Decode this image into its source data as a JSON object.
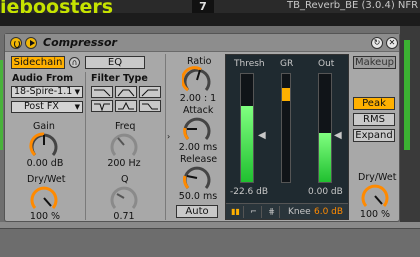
{
  "topbar": {
    "logo": "ieboosters",
    "key": "7",
    "track_name": "TB_Reverb_BE (3.0.4) NFR"
  },
  "device": {
    "title": "Compressor",
    "sidechain_label": "Sidechain",
    "eq_label": "EQ",
    "audio_from_label": "Audio From",
    "audio_from_value": "18-Spire-1.1",
    "post_fx_value": "Post FX",
    "filter_type_label": "Filter Type",
    "gain": {
      "label": "Gain",
      "value": "0.00 dB"
    },
    "sc_drywet": {
      "label": "Dry/Wet",
      "value": "100 %"
    },
    "freq": {
      "label": "Freq",
      "value": "200 Hz"
    },
    "q": {
      "label": "Q",
      "value": "0.71"
    },
    "ratio": {
      "label": "Ratio",
      "value": "2.00 : 1"
    },
    "attack": {
      "label": "Attack",
      "value": "2.00 ms"
    },
    "release": {
      "label": "Release",
      "value": "50.0 ms"
    },
    "auto_label": "Auto",
    "makeup_label": "Makeup",
    "peak_label": "Peak",
    "rms_label": "RMS",
    "expand_label": "Expand",
    "drywet": {
      "label": "Dry/Wet",
      "value": "100 %"
    },
    "meters": {
      "thresh_label": "Thresh",
      "gr_label": "GR",
      "out_label": "Out",
      "thresh_value": "-22.6 dB",
      "out_value": "0.00 dB",
      "knee_label": "Knee",
      "knee_value": "6.0 dB",
      "thresh_level": 0.7,
      "gr_level": 0.12,
      "out_level": 0.45
    },
    "colors": {
      "accent": "#ffb000",
      "meter_green": "#20c030",
      "knee_value": "#ff8a00"
    }
  }
}
